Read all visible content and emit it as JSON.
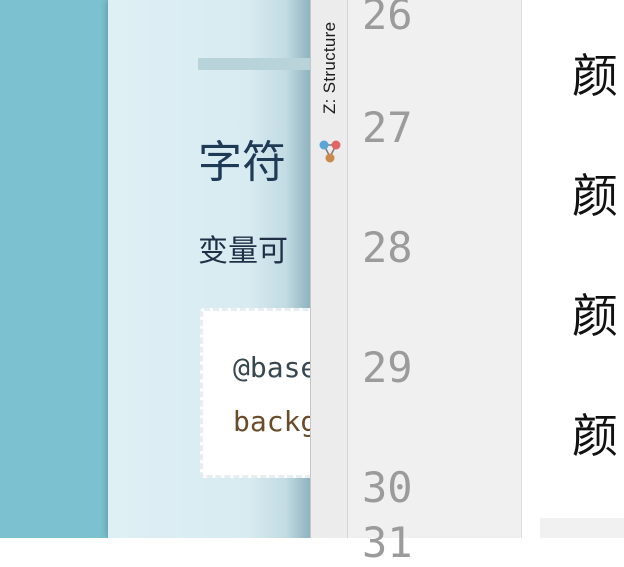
{
  "preview": {
    "heading": "字符",
    "paragraph": "变量可",
    "code": {
      "line1": "@base",
      "line2": "backg"
    }
  },
  "tool_window": {
    "label": "Z: Structure",
    "icon": "structure-icon"
  },
  "gutter": {
    "line_numbers": [
      "26",
      "27",
      "28",
      "29",
      "30",
      "31"
    ]
  },
  "editor": {
    "lines": [
      "颜",
      "颜",
      "颜",
      "颜"
    ]
  },
  "colors": {
    "preview_background": "#7cc1cf",
    "preview_page": "#dff0f5",
    "heading_text": "#1f3a55",
    "line_number": "#9b9b9b",
    "gutter_background": "#f0f0f0"
  }
}
